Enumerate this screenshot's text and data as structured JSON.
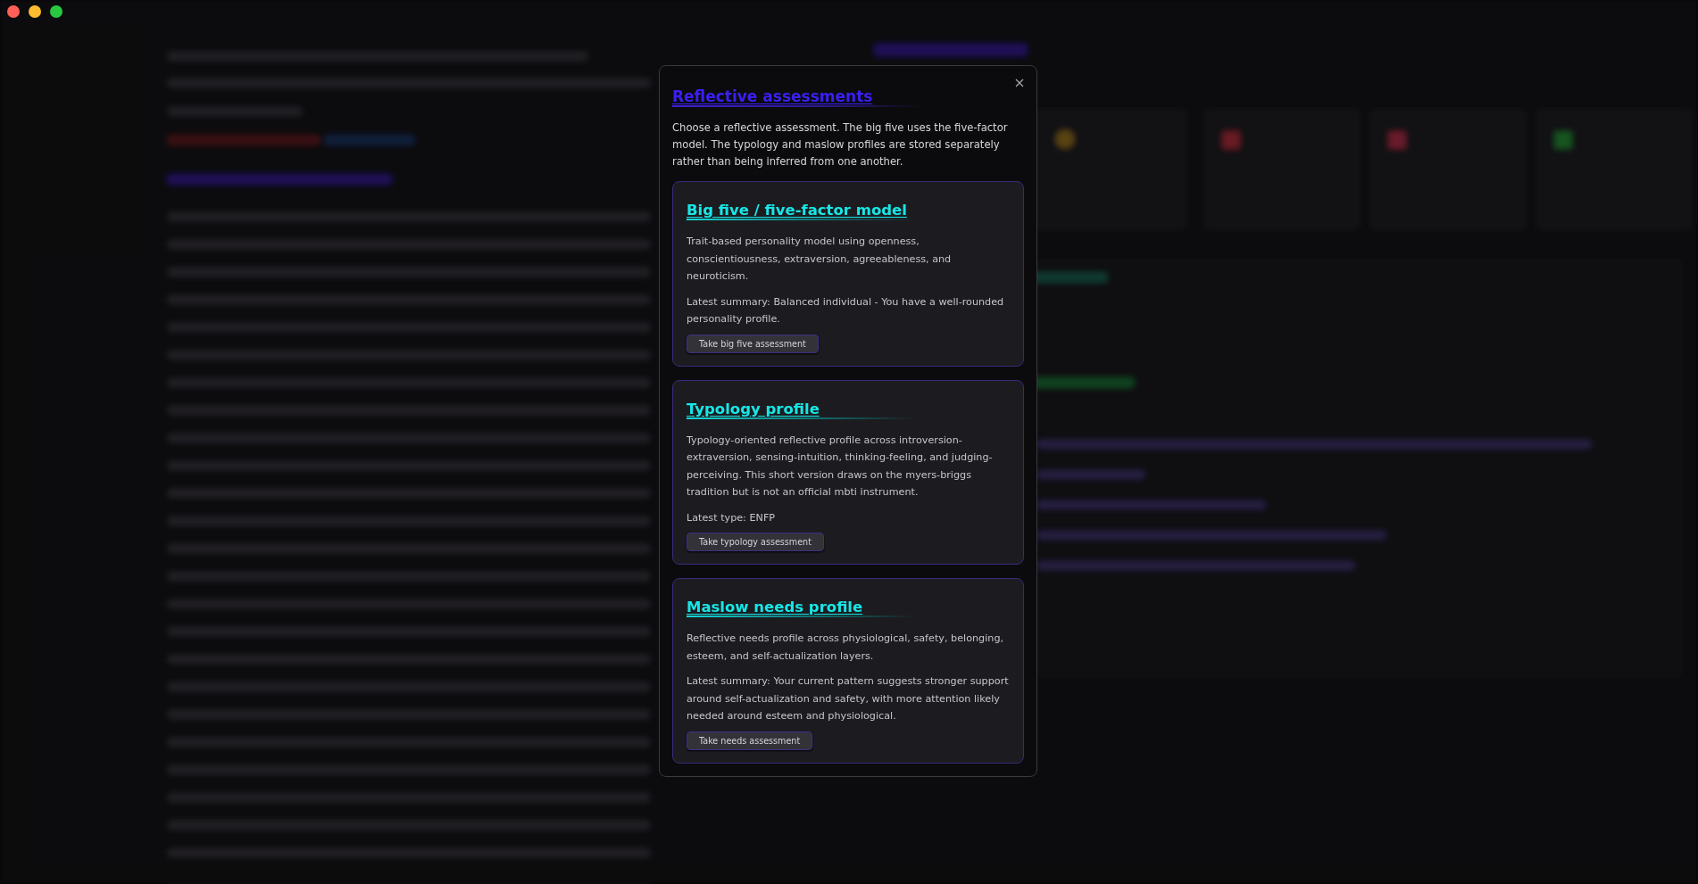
{
  "modal": {
    "title": "Reflective assessments",
    "intro": "Choose a reflective assessment. The big five uses the five-factor model. The typology and maslow profiles are stored separately rather than being inferred from one another.",
    "cards": [
      {
        "title": "Big five / five-factor model",
        "description": "Trait-based personality model using openness, conscientiousness, extraversion, agreeableness, and neuroticism.",
        "summary": "Latest summary: Balanced individual - You have a well-rounded personality profile.",
        "button": "Take big five assessment"
      },
      {
        "title": "Typology profile",
        "description": "Typology-oriented reflective profile across introversion-extraversion, sensing-intuition, thinking-feeling, and judging-perceiving. This short version draws on the myers-briggs tradition but is not an official mbti instrument.",
        "summary": "Latest type: ENFP",
        "button": "Take typology assessment"
      },
      {
        "title": "Maslow needs profile",
        "description": "Reflective needs profile across physiological, safety, belonging, esteem, and self-actualization layers.",
        "summary": "Latest summary: Your current pattern suggests stronger support around self-actualization and safety, with more attention likely needed around esteem and physiological.",
        "button": "Take needs assessment"
      }
    ]
  }
}
